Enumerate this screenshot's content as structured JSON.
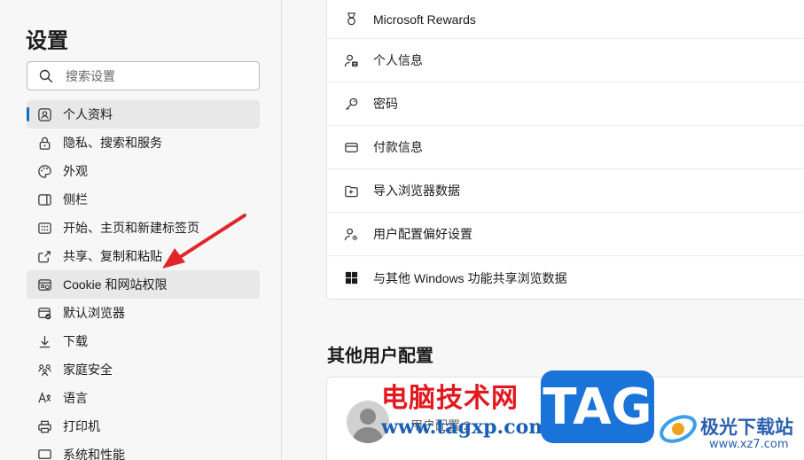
{
  "sidebar": {
    "title": "设置",
    "search": {
      "placeholder": "搜索设置",
      "icon": "search-icon"
    },
    "items": [
      {
        "label": "个人资料",
        "icon": "profile-icon",
        "state": "active"
      },
      {
        "label": "隐私、搜索和服务",
        "icon": "lock-icon"
      },
      {
        "label": "外观",
        "icon": "palette-icon"
      },
      {
        "label": "侧栏",
        "icon": "sidebar-icon"
      },
      {
        "label": "开始、主页和新建标签页",
        "icon": "home-icon"
      },
      {
        "label": "共享、复制和粘贴",
        "icon": "share-icon"
      },
      {
        "label": "Cookie 和网站权限",
        "icon": "cookie-icon",
        "state": "hover"
      },
      {
        "label": "默认浏览器",
        "icon": "browser-icon"
      },
      {
        "label": "下载",
        "icon": "download-icon"
      },
      {
        "label": "家庭安全",
        "icon": "family-icon"
      },
      {
        "label": "语言",
        "icon": "language-icon"
      },
      {
        "label": "打印机",
        "icon": "printer-icon"
      },
      {
        "label": "系统和性能",
        "icon": "system-icon"
      }
    ]
  },
  "main": {
    "rows": [
      {
        "label": "Microsoft Rewards",
        "icon": "rewards-icon"
      },
      {
        "label": "个人信息",
        "icon": "personal-info-icon"
      },
      {
        "label": "密码",
        "icon": "key-icon"
      },
      {
        "label": "付款信息",
        "icon": "card-icon"
      },
      {
        "label": "导入浏览器数据",
        "icon": "import-icon"
      },
      {
        "label": "用户配置偏好设置",
        "icon": "profile-settings-icon"
      },
      {
        "label": "与其他 Windows 功能共享浏览数据",
        "icon": "windows-icon"
      }
    ],
    "other_profiles": {
      "title": "其他用户配置",
      "profile_name": "用户配置 2"
    }
  },
  "watermark": {
    "cn_text": "电脑技术网",
    "url": "www.tagxp.com",
    "tag": "TAG",
    "jg_text": "极光下载站",
    "jg_url": "www.xz7.com"
  },
  "colors": {
    "accent": "#0f6cbd",
    "arrow": "#e0262b",
    "watermark_red": "#e3181f",
    "watermark_blue": "#1a73d9"
  }
}
